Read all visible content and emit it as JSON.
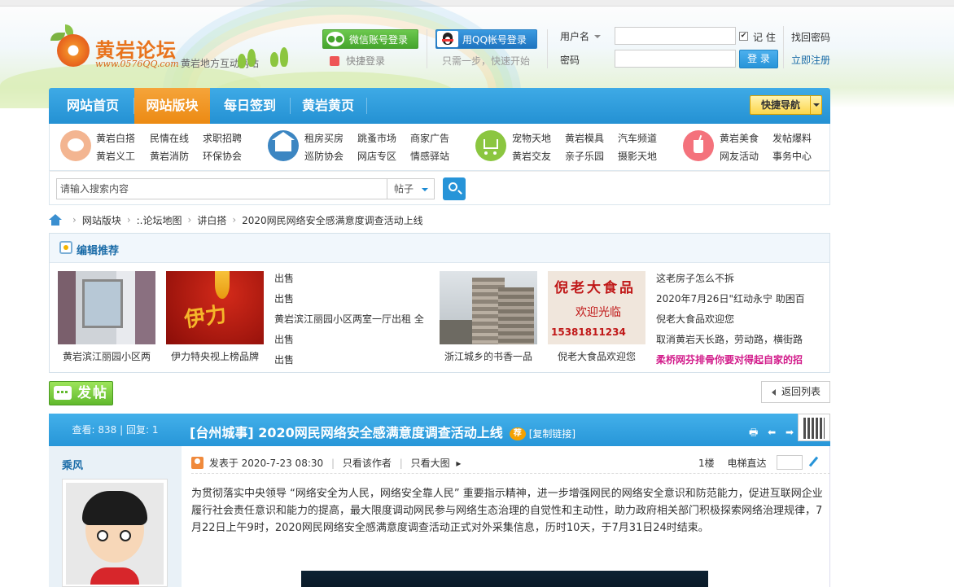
{
  "site": {
    "logo_title": "黄岩论坛",
    "logo_url": "www.0576QQ.com",
    "slogan": "黄岩地方互动网站"
  },
  "login": {
    "wechat_label": "微信账号登录",
    "quick_label": "快捷登录",
    "qq_label": "用QQ帐号登录",
    "qq_sub": "只需一步，快速开始",
    "username_label": "用户名",
    "password_label": "密码",
    "remember_label": "记 住",
    "remember_checked": "✔",
    "find_password": "找回密码",
    "register": "立即注册",
    "login_button": "登 录"
  },
  "nav": {
    "items": [
      {
        "label": "网站首页"
      },
      {
        "label": "网站版块",
        "active": true
      },
      {
        "label": "每日签到"
      },
      {
        "label": "黄岩黄页"
      }
    ],
    "quick_nav": "快捷导航"
  },
  "categories": {
    "group1": [
      "黄岩白搭",
      "民情在线",
      "求职招聘",
      "黄岩义工",
      "黄岩消防",
      "环保协会"
    ],
    "group2": [
      "租房买房",
      "跳蚤市场",
      "商家广告",
      "巡防协会",
      "网店专区",
      "情感驿站"
    ],
    "group3": [
      "宠物天地",
      "黄岩模具",
      "汽车频道",
      "黄岩交友",
      "亲子乐园",
      "摄影天地"
    ],
    "group4": [
      "黄岩美食",
      "发帖爆料",
      "网友活动",
      "事务中心"
    ],
    "icon_colors": [
      "#f3b591",
      "#3c86c2",
      "#8bc640",
      "#f4727c"
    ]
  },
  "search": {
    "placeholder": "请输入搜索内容",
    "type": "帖子"
  },
  "breadcrumb": [
    "网站版块",
    ":.论坛地图",
    "讲白搭",
    "2020网民网络安全感满意度调查活动上线"
  ],
  "recommend": {
    "title": "编辑推荐",
    "pics_left": [
      {
        "caption": "黄岩滨江丽园小区两"
      },
      {
        "caption": "伊力特央视上榜品牌"
      }
    ],
    "list_left": [
      "出售",
      "出售",
      "黄岩滨江丽园小区两室一厅出租 全",
      "出售",
      "出售"
    ],
    "pics_right": [
      {
        "caption": "浙江城乡的书香一品"
      },
      {
        "caption": "倪老大食品欢迎您"
      }
    ],
    "list_right": [
      "这老房子怎么不拆",
      "2020年7月26日\"红动永宁 助困百",
      "倪老大食品欢迎您",
      "取消黄岩天长路，劳动路，横街路",
      "柔桥网芬排骨你要对得起自家的招"
    ],
    "ad_text": "倪老大食品",
    "ad_sub": "欢迎光临",
    "ad_phone": "15381811234",
    "pic2_text": "伊力"
  },
  "actions": {
    "post": "发帖",
    "back": "返回列表"
  },
  "thread": {
    "stats": "查看: 838 | 回复: 1",
    "title": "[台州城事] 2020网民网络安全感满意度调查活动上线",
    "tag": "荐",
    "copy_link": "[复制链接]",
    "tools": "🖶 ⬅ ➡",
    "author": "乘风",
    "posted": "发表于 2020-7-23 08:30",
    "only_author": "只看该作者",
    "only_pic": "只看大图",
    "floor": "1楼",
    "elevator": "电梯直达",
    "content": "为贯彻落实中央领导 “网络安全为人民，网络安全靠人民” 重要指示精神，进一步增强网民的网络安全意识和防范能力，促进互联网企业履行社会责任意识和能力的提高，最大限度调动网民参与网络生态治理的自觉性和主动性，助力政府相关部门积极探索网络治理规律，7月22日上午9时，2020网民网络安全感满意度调查活动正式对外采集信息，历时10天，于7月31日24时结束。"
  }
}
